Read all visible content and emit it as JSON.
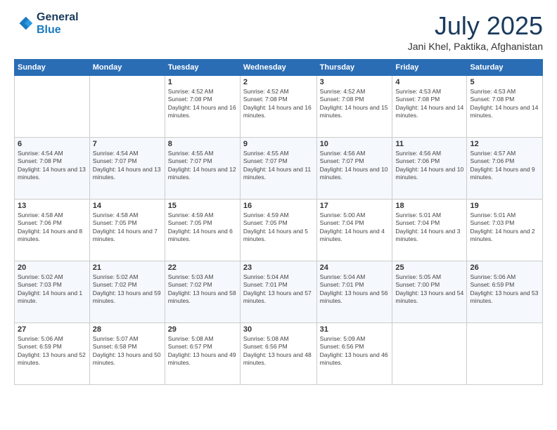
{
  "logo": {
    "line1": "General",
    "line2": "Blue"
  },
  "title": "July 2025",
  "subtitle": "Jani Khel, Paktika, Afghanistan",
  "weekdays": [
    "Sunday",
    "Monday",
    "Tuesday",
    "Wednesday",
    "Thursday",
    "Friday",
    "Saturday"
  ],
  "weeks": [
    [
      {
        "day": "",
        "info": ""
      },
      {
        "day": "",
        "info": ""
      },
      {
        "day": "1",
        "info": "Sunrise: 4:52 AM\nSunset: 7:08 PM\nDaylight: 14 hours and 16 minutes."
      },
      {
        "day": "2",
        "info": "Sunrise: 4:52 AM\nSunset: 7:08 PM\nDaylight: 14 hours and 16 minutes."
      },
      {
        "day": "3",
        "info": "Sunrise: 4:52 AM\nSunset: 7:08 PM\nDaylight: 14 hours and 15 minutes."
      },
      {
        "day": "4",
        "info": "Sunrise: 4:53 AM\nSunset: 7:08 PM\nDaylight: 14 hours and 14 minutes."
      },
      {
        "day": "5",
        "info": "Sunrise: 4:53 AM\nSunset: 7:08 PM\nDaylight: 14 hours and 14 minutes."
      }
    ],
    [
      {
        "day": "6",
        "info": "Sunrise: 4:54 AM\nSunset: 7:08 PM\nDaylight: 14 hours and 13 minutes."
      },
      {
        "day": "7",
        "info": "Sunrise: 4:54 AM\nSunset: 7:07 PM\nDaylight: 14 hours and 13 minutes."
      },
      {
        "day": "8",
        "info": "Sunrise: 4:55 AM\nSunset: 7:07 PM\nDaylight: 14 hours and 12 minutes."
      },
      {
        "day": "9",
        "info": "Sunrise: 4:55 AM\nSunset: 7:07 PM\nDaylight: 14 hours and 11 minutes."
      },
      {
        "day": "10",
        "info": "Sunrise: 4:56 AM\nSunset: 7:07 PM\nDaylight: 14 hours and 10 minutes."
      },
      {
        "day": "11",
        "info": "Sunrise: 4:56 AM\nSunset: 7:06 PM\nDaylight: 14 hours and 10 minutes."
      },
      {
        "day": "12",
        "info": "Sunrise: 4:57 AM\nSunset: 7:06 PM\nDaylight: 14 hours and 9 minutes."
      }
    ],
    [
      {
        "day": "13",
        "info": "Sunrise: 4:58 AM\nSunset: 7:06 PM\nDaylight: 14 hours and 8 minutes."
      },
      {
        "day": "14",
        "info": "Sunrise: 4:58 AM\nSunset: 7:05 PM\nDaylight: 14 hours and 7 minutes."
      },
      {
        "day": "15",
        "info": "Sunrise: 4:59 AM\nSunset: 7:05 PM\nDaylight: 14 hours and 6 minutes."
      },
      {
        "day": "16",
        "info": "Sunrise: 4:59 AM\nSunset: 7:05 PM\nDaylight: 14 hours and 5 minutes."
      },
      {
        "day": "17",
        "info": "Sunrise: 5:00 AM\nSunset: 7:04 PM\nDaylight: 14 hours and 4 minutes."
      },
      {
        "day": "18",
        "info": "Sunrise: 5:01 AM\nSunset: 7:04 PM\nDaylight: 14 hours and 3 minutes."
      },
      {
        "day": "19",
        "info": "Sunrise: 5:01 AM\nSunset: 7:03 PM\nDaylight: 14 hours and 2 minutes."
      }
    ],
    [
      {
        "day": "20",
        "info": "Sunrise: 5:02 AM\nSunset: 7:03 PM\nDaylight: 14 hours and 1 minute."
      },
      {
        "day": "21",
        "info": "Sunrise: 5:02 AM\nSunset: 7:02 PM\nDaylight: 13 hours and 59 minutes."
      },
      {
        "day": "22",
        "info": "Sunrise: 5:03 AM\nSunset: 7:02 PM\nDaylight: 13 hours and 58 minutes."
      },
      {
        "day": "23",
        "info": "Sunrise: 5:04 AM\nSunset: 7:01 PM\nDaylight: 13 hours and 57 minutes."
      },
      {
        "day": "24",
        "info": "Sunrise: 5:04 AM\nSunset: 7:01 PM\nDaylight: 13 hours and 56 minutes."
      },
      {
        "day": "25",
        "info": "Sunrise: 5:05 AM\nSunset: 7:00 PM\nDaylight: 13 hours and 54 minutes."
      },
      {
        "day": "26",
        "info": "Sunrise: 5:06 AM\nSunset: 6:59 PM\nDaylight: 13 hours and 53 minutes."
      }
    ],
    [
      {
        "day": "27",
        "info": "Sunrise: 5:06 AM\nSunset: 6:59 PM\nDaylight: 13 hours and 52 minutes."
      },
      {
        "day": "28",
        "info": "Sunrise: 5:07 AM\nSunset: 6:58 PM\nDaylight: 13 hours and 50 minutes."
      },
      {
        "day": "29",
        "info": "Sunrise: 5:08 AM\nSunset: 6:57 PM\nDaylight: 13 hours and 49 minutes."
      },
      {
        "day": "30",
        "info": "Sunrise: 5:08 AM\nSunset: 6:56 PM\nDaylight: 13 hours and 48 minutes."
      },
      {
        "day": "31",
        "info": "Sunrise: 5:09 AM\nSunset: 6:56 PM\nDaylight: 13 hours and 46 minutes."
      },
      {
        "day": "",
        "info": ""
      },
      {
        "day": "",
        "info": ""
      }
    ]
  ]
}
